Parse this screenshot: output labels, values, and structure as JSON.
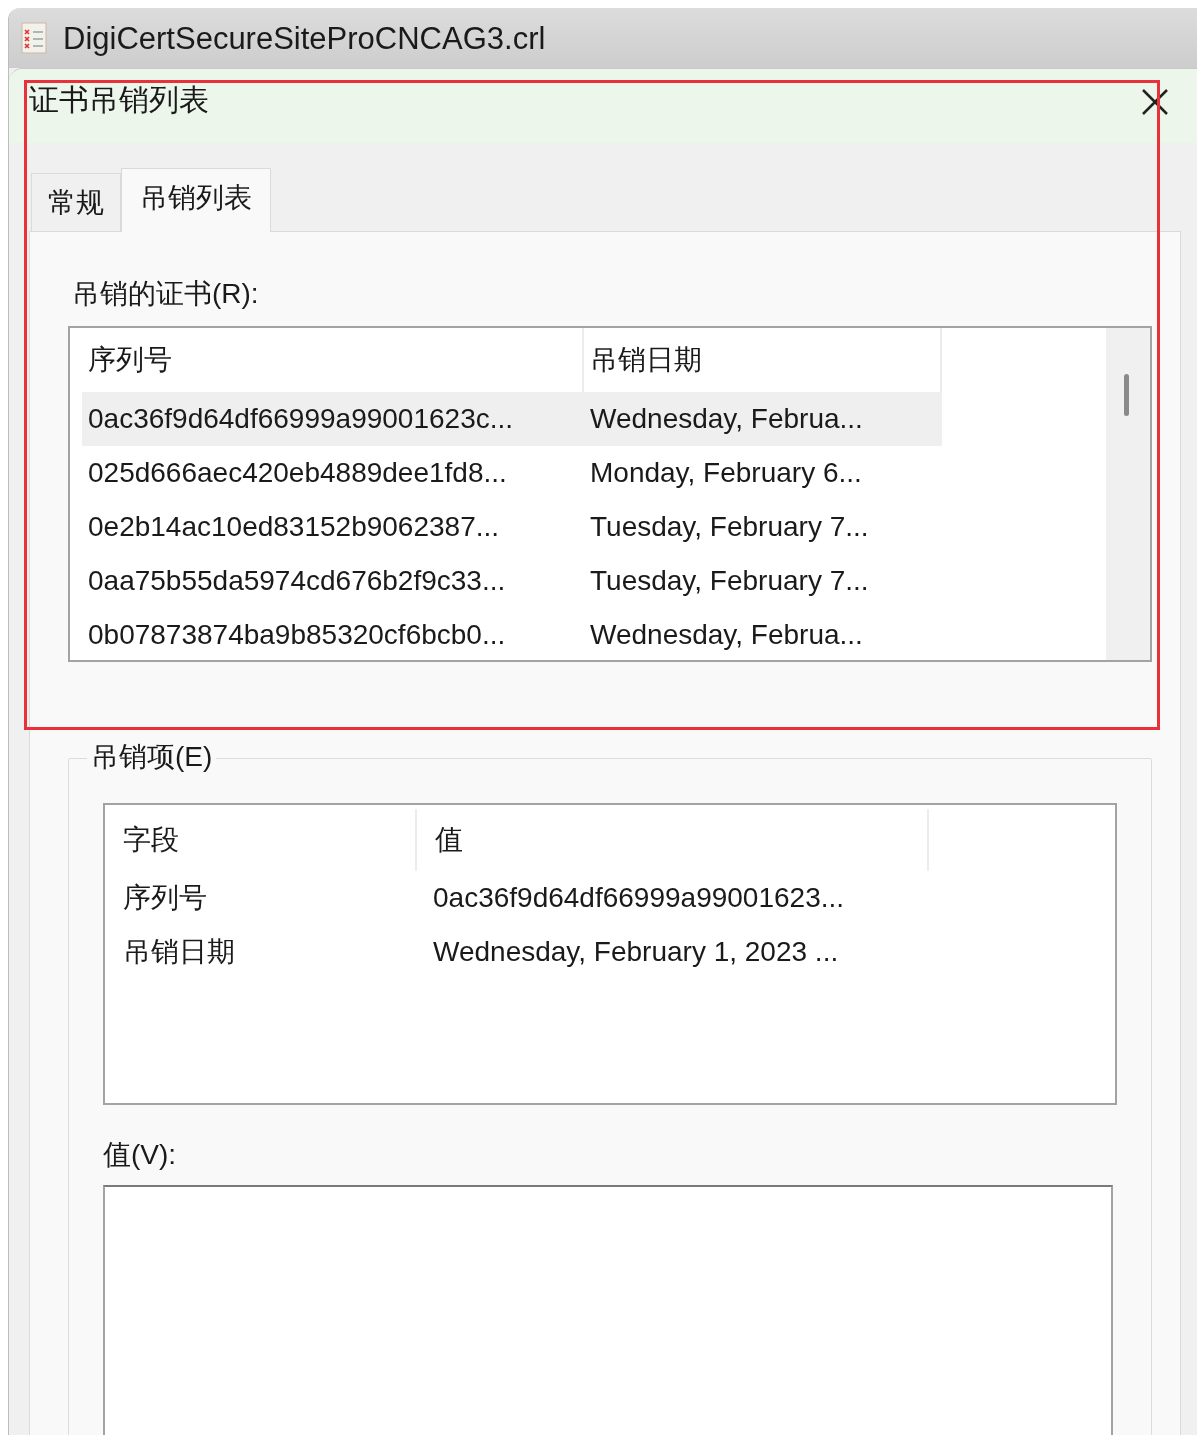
{
  "window": {
    "title": "DigiCertSecureSiteProCNCAG3.crl"
  },
  "dialog": {
    "title": "证书吊销列表"
  },
  "tabs": [
    {
      "label": "常规",
      "selected": false
    },
    {
      "label": "吊销列表",
      "selected": true
    }
  ],
  "revoked_certificates": {
    "label": "吊销的证书(R):",
    "columns": [
      "序列号",
      "吊销日期"
    ],
    "rows": [
      {
        "serial": "0ac36f9d64df66999a99001623c...",
        "date": "Wednesday, Februa...",
        "selected": true
      },
      {
        "serial": "025d666aec420eb4889dee1fd8...",
        "date": "Monday, February 6...",
        "selected": false
      },
      {
        "serial": "0e2b14ac10ed83152b9062387...",
        "date": "Tuesday, February 7...",
        "selected": false
      },
      {
        "serial": "0aa75b55da5974cd676b2f9c33...",
        "date": "Tuesday, February 7...",
        "selected": false
      },
      {
        "serial": "0b07873874ba9b85320cf6bcb0...",
        "date": "Wednesday, Februa...",
        "selected": false
      }
    ]
  },
  "revocation_entry": {
    "label": "吊销项(E)",
    "columns": [
      "字段",
      "值"
    ],
    "rows": [
      {
        "field": "序列号",
        "value": "0ac36f9d64df66999a99001623..."
      },
      {
        "field": "吊销日期",
        "value": "Wednesday, February 1, 2023 ..."
      }
    ]
  },
  "value_label": "值(V):"
}
